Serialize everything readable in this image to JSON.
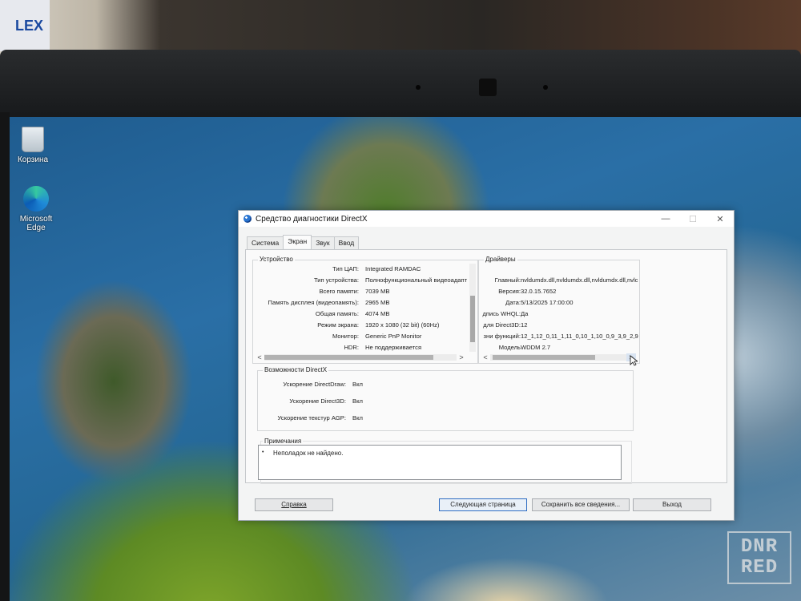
{
  "photo": {
    "poster_text": "LEX"
  },
  "desktop": {
    "icons": [
      {
        "label": "Корзина"
      },
      {
        "label": "Microsoft Edge"
      }
    ]
  },
  "window": {
    "title": "Средство диагностики DirectX",
    "controls": {
      "minimize": "—",
      "maximize": "☐",
      "close": "✕"
    },
    "tabs": [
      "Система",
      "Экран",
      "Звук",
      "Ввод"
    ],
    "active_tab": "Экран",
    "device": {
      "title": "Устройство",
      "rows": [
        {
          "label": "Тип ЦАП:",
          "value": "Integrated RAMDAC"
        },
        {
          "label": "Тип устройства:",
          "value": "Полнофункциональный видеоадапт"
        },
        {
          "label": "Всего памяти:",
          "value": "7039 MB"
        },
        {
          "label": "Память дисплея (видеопамять):",
          "value": "2965 MB"
        },
        {
          "label": "Общая память:",
          "value": "4074 MB"
        },
        {
          "label": "Режим экрана:",
          "value": "1920 x 1080 (32 bit) (60Hz)"
        },
        {
          "label": "Монитор:",
          "value": "Generic PnP Monitor"
        },
        {
          "label": "HDR:",
          "value": "Не поддерживается"
        }
      ]
    },
    "drivers": {
      "title": "Драйверы",
      "rows": [
        {
          "label": "Главный:",
          "value": "nvldumdx.dll,nvldumdx.dll,nvldumdx.dll,nvlc"
        },
        {
          "label": "Версия:",
          "value": "32.0.15.7652"
        },
        {
          "label": "Дата:",
          "value": "5/13/2025 17:00:00"
        },
        {
          "label": "дпись WHQL:",
          "value": "Да"
        },
        {
          "label": "для Direct3D:",
          "value": "12"
        },
        {
          "label": "зни функций:",
          "value": "12_1,12_0,11_1,11_0,10_1,10_0,9_3,9_2,9"
        },
        {
          "label": "Модель",
          "value": "WDDM 2.7"
        }
      ]
    },
    "capabilities": {
      "title": "Возможности DirectX",
      "rows": [
        {
          "label": "Ускорение DirectDraw:",
          "value": "Вкл"
        },
        {
          "label": "Ускорение Direct3D:",
          "value": "Вкл"
        },
        {
          "label": "Ускорение текстур AGP:",
          "value": "Вкл"
        }
      ]
    },
    "notes": {
      "title": "Примечания",
      "bullet": "•",
      "items": [
        "Неполадок не найдено."
      ]
    },
    "buttons": {
      "help": "Справка",
      "next": "Следующая страница",
      "save": "Сохранить все сведения...",
      "exit": "Выход"
    },
    "arrows": {
      "left": "<",
      "right": ">"
    }
  },
  "watermark": {
    "line1": "DNR",
    "line2": "RED"
  }
}
